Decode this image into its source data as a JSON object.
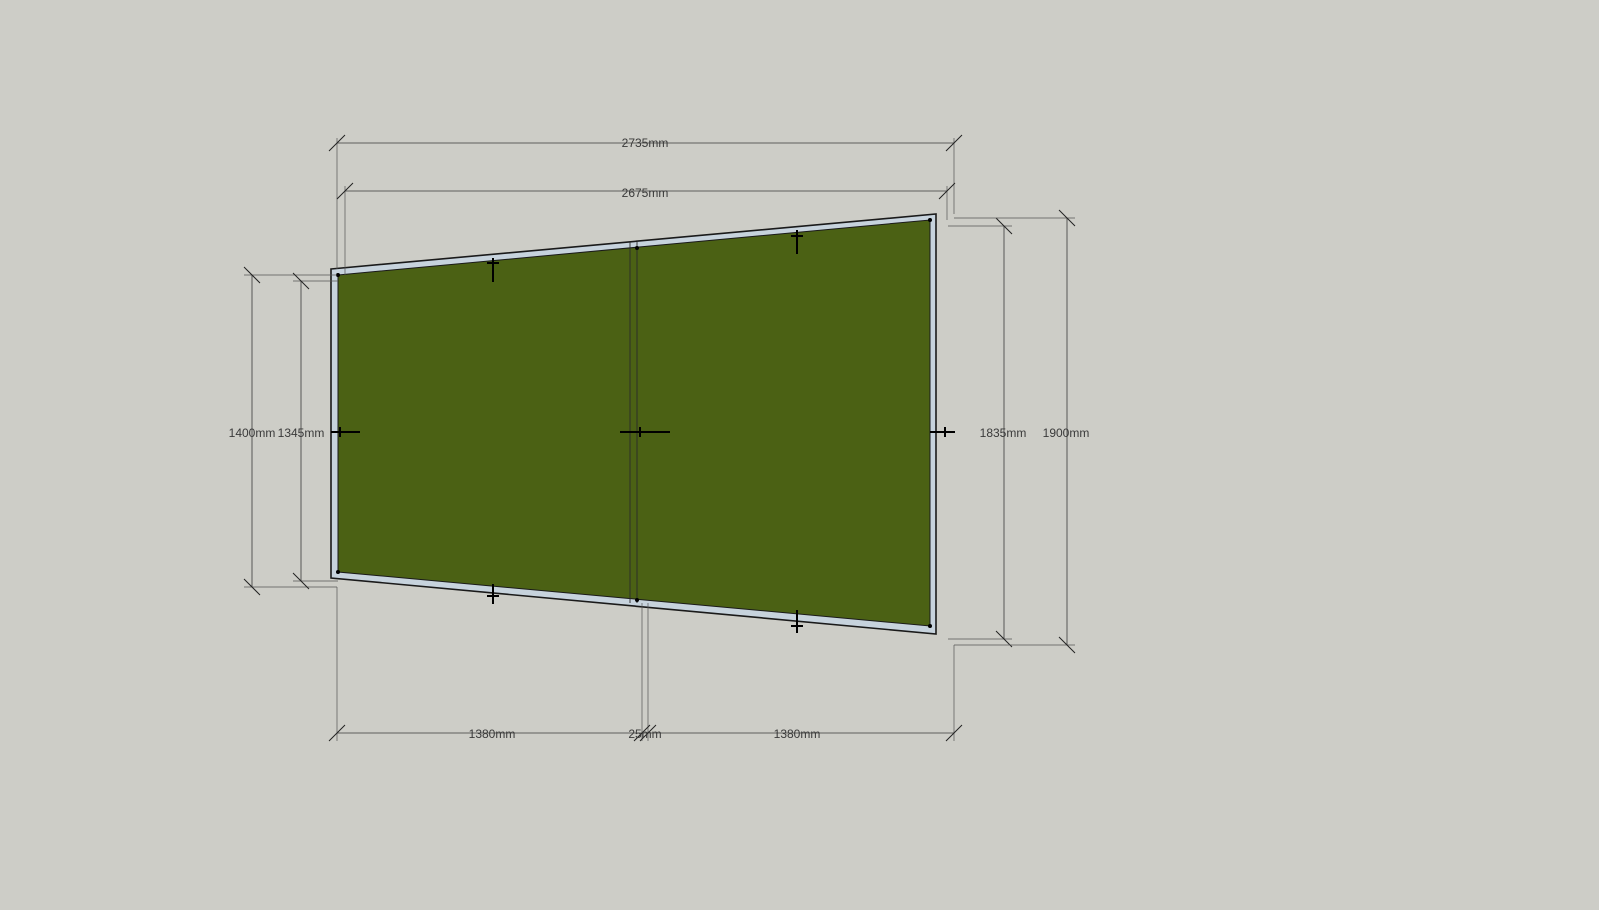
{
  "colors": {
    "background": "#cdcdc7",
    "fabric": "#4b6114",
    "frame": "#c7d3dd",
    "outline": "#1a1a1a",
    "dimension_line": "#3a3a3a"
  },
  "dimensions": {
    "overall_width": "2735mm",
    "inner_width": "2675mm",
    "left_outer_height": "1400mm",
    "left_inner_height": "1345mm",
    "right_inner_height": "1835mm",
    "right_outer_height": "1900mm",
    "bottom_left_width": "1380mm",
    "center_gap": "25mm",
    "bottom_right_width": "1380mm"
  }
}
